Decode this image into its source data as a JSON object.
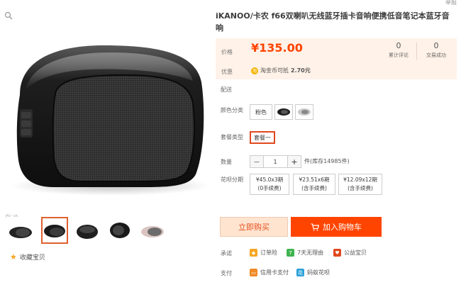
{
  "top": {
    "report": "举报"
  },
  "product": {
    "title": "iKANOO/卡农 f66双喇叭无线蓝牙插卡音响便携低音笔记本蓝牙音响"
  },
  "price": {
    "label": "价格",
    "value": "¥135.00",
    "reviews_count": "0",
    "reviews_label": "累计评论",
    "sales_count": "0",
    "sales_label": "交易成功",
    "promo_label": "优惠",
    "coin_icon": "coin-icon",
    "coin_text": "淘金币可抵",
    "coin_amount": "2.70元"
  },
  "delivery": {
    "label": "配送"
  },
  "color": {
    "label": "颜色分类",
    "options": [
      "粉色",
      "",
      ""
    ]
  },
  "package": {
    "label": "套餐类型",
    "selected": "套餐一"
  },
  "quantity": {
    "label": "数量",
    "minus": "−",
    "value": "1",
    "plus": "+",
    "stock": "件(库存14985件)"
  },
  "installment": {
    "label": "花呗分期",
    "options": [
      {
        "line1": "¥45.0x3期",
        "line2": "(0手续费)"
      },
      {
        "line1": "¥23.51x6期",
        "line2": "(含手续费)"
      },
      {
        "line1": "¥12.09x12期",
        "line2": "(含手续费)"
      }
    ]
  },
  "actions": {
    "buy_now": "立即购买",
    "add_cart": "加入购物车",
    "cart_icon": "cart-icon"
  },
  "services": {
    "promise_label": "承诺",
    "promise_items": [
      {
        "icon": "shield-icon",
        "text": "订单险",
        "color": "#f5a623"
      },
      {
        "icon": "seven-day-icon",
        "text": "7天无理由",
        "color": "#3fb34f"
      },
      {
        "icon": "genuine-icon",
        "text": "公益宝贝",
        "color": "#e0481e"
      }
    ],
    "pay_label": "支付",
    "pay_items": [
      {
        "icon": "credit-card-icon",
        "text": "信用卡支付",
        "color": "#f08a24"
      },
      {
        "icon": "huabei-icon",
        "text": "蚂蚁花呗",
        "color": "#2aa0d8"
      }
    ]
  },
  "gallery": {
    "tag": "Pic.sb",
    "favorite_icon": "star-icon",
    "favorite_text": "收藏宝贝",
    "zoom_icon": "zoom-icon"
  },
  "colors": {
    "accent": "#ff4400",
    "price_bg": "#fff2e8",
    "buy_now_bg": "#ffe4d0"
  }
}
